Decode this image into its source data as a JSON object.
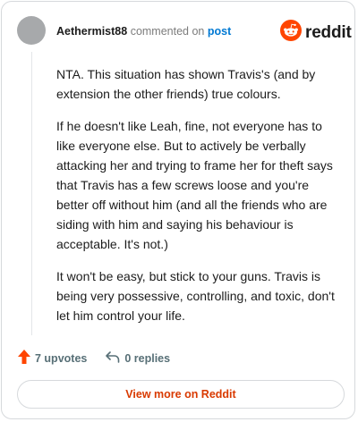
{
  "header": {
    "username": "Aethermist88",
    "action_text": "commented on",
    "post_link": "post",
    "brand": "reddit",
    "avatar_icon": "user-avatar",
    "logo_icon": "reddit-alien-icon"
  },
  "comment": {
    "paragraphs": [
      "NTA. This situation has shown Travis's (and by extension the other friends) true colours.",
      "If he doesn't like Leah, fine, not everyone has to like everyone else. But to actively be verbally attacking her and trying to frame her for theft says that Travis has a few screws loose and you're better off without him (and all the friends who are siding with him and saying his behaviour is acceptable. It's not.)",
      "It won't be easy, but stick to your guns. Travis is being very possessive, controlling, and toxic, don't let him control your life."
    ]
  },
  "actions": {
    "upvotes": "7 upvotes",
    "replies": "0 replies",
    "upvote_icon": "upvote-arrow-icon",
    "reply_icon": "reply-arrow-icon"
  },
  "footer": {
    "view_more": "View more on Reddit"
  },
  "colors": {
    "brand_orange": "#ff4500",
    "link_blue": "#0079d3",
    "cta_orange": "#d93a00"
  }
}
